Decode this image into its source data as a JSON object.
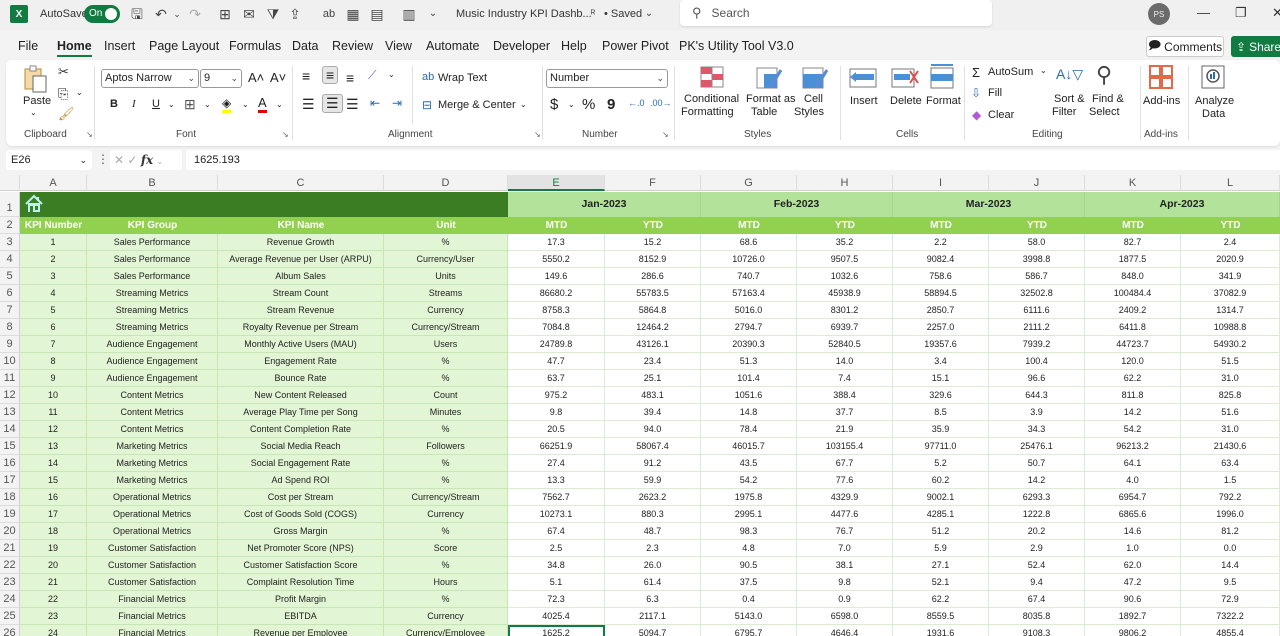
{
  "titlebar": {
    "app_logo": "X",
    "autosave_label": "AutoSave",
    "autosave_state": "On",
    "doc_title": "Music Industry KPI Dashb...",
    "saved_status": "• Saved",
    "search_placeholder": "Search",
    "user_initials": "PS"
  },
  "menu": {
    "tabs": [
      "File",
      "Home",
      "Insert",
      "Page Layout",
      "Formulas",
      "Data",
      "Review",
      "View",
      "Automate",
      "Developer",
      "Help",
      "Power Pivot",
      "PK's Utility Tool V3.0"
    ],
    "active_tab": "Home",
    "comments_label": "Comments",
    "share_label": "Share"
  },
  "ribbon": {
    "clipboard": {
      "paste": "Paste",
      "label": "Clipboard"
    },
    "font": {
      "name": "Aptos Narrow",
      "size": "9",
      "label": "Font",
      "bold": "B",
      "italic": "I",
      "underline": "U"
    },
    "alignment": {
      "wrap_text": "Wrap Text",
      "merge_center": "Merge & Center",
      "label": "Alignment"
    },
    "number": {
      "format": "Number",
      "currency": "$",
      "percent": "%",
      "comma": "9",
      "label": "Number"
    },
    "styles": {
      "conditional": "Conditional",
      "conditional2": "Formatting",
      "format_as": "Format as",
      "format_as2": "Table",
      "cell": "Cell",
      "cell2": "Styles",
      "label": "Styles"
    },
    "cells": {
      "insert": "Insert",
      "delete": "Delete",
      "format": "Format",
      "label": "Cells"
    },
    "editing": {
      "autosum": "AutoSum",
      "fill": "Fill",
      "clear": "Clear",
      "sort": "Sort &",
      "sort2": "Filter",
      "find": "Find &",
      "find2": "Select",
      "label": "Editing"
    },
    "addins": {
      "addins": "Add-ins",
      "label": "Add-ins"
    },
    "analyze": {
      "line1": "Analyze",
      "line2": "Data"
    }
  },
  "formula_bar": {
    "name_box": "E26",
    "formula": "1625.193"
  },
  "sheet": {
    "columns": [
      "A",
      "B",
      "C",
      "D",
      "E",
      "F",
      "G",
      "H",
      "I",
      "J",
      "K",
      "L"
    ],
    "selected_column": "E",
    "selected_cell": "E26",
    "header_row": [
      "KPI Number",
      "KPI Group",
      "KPI Name",
      "Unit"
    ],
    "months": [
      "Jan-2023",
      "Feb-2023",
      "Mar-2023",
      "Apr-2023"
    ],
    "sub_headers": [
      "MTD",
      "YTD"
    ],
    "rows": [
      {
        "n": "1",
        "group": "Sales Performance",
        "name": "Revenue Growth",
        "unit": "%",
        "vals": [
          "17.3",
          "15.2",
          "68.6",
          "35.2",
          "2.2",
          "58.0",
          "82.7",
          "2.4"
        ]
      },
      {
        "n": "2",
        "group": "Sales Performance",
        "name": "Average Revenue per User (ARPU)",
        "unit": "Currency/User",
        "vals": [
          "5550.2",
          "8152.9",
          "10726.0",
          "9507.5",
          "9082.4",
          "3998.8",
          "1877.5",
          "2020.9"
        ]
      },
      {
        "n": "3",
        "group": "Sales Performance",
        "name": "Album Sales",
        "unit": "Units",
        "vals": [
          "149.6",
          "286.6",
          "740.7",
          "1032.6",
          "758.6",
          "586.7",
          "848.0",
          "341.9"
        ]
      },
      {
        "n": "4",
        "group": "Streaming Metrics",
        "name": "Stream Count",
        "unit": "Streams",
        "vals": [
          "86680.2",
          "55783.5",
          "57163.4",
          "45938.9",
          "58894.5",
          "32502.8",
          "100484.4",
          "37082.9"
        ]
      },
      {
        "n": "5",
        "group": "Streaming Metrics",
        "name": "Stream Revenue",
        "unit": "Currency",
        "vals": [
          "8758.3",
          "5864.8",
          "5016.0",
          "8301.2",
          "2850.7",
          "6111.6",
          "2409.2",
          "1314.7"
        ]
      },
      {
        "n": "6",
        "group": "Streaming Metrics",
        "name": "Royalty Revenue per Stream",
        "unit": "Currency/Stream",
        "vals": [
          "7084.8",
          "12464.2",
          "2794.7",
          "6939.7",
          "2257.0",
          "2111.2",
          "6411.8",
          "10988.8"
        ]
      },
      {
        "n": "7",
        "group": "Audience Engagement",
        "name": "Monthly Active Users (MAU)",
        "unit": "Users",
        "vals": [
          "24789.8",
          "43126.1",
          "20390.3",
          "52840.5",
          "19357.6",
          "7939.2",
          "44723.7",
          "54930.2"
        ]
      },
      {
        "n": "8",
        "group": "Audience Engagement",
        "name": "Engagement Rate",
        "unit": "%",
        "vals": [
          "47.7",
          "23.4",
          "51.3",
          "14.0",
          "3.4",
          "100.4",
          "120.0",
          "51.5"
        ]
      },
      {
        "n": "9",
        "group": "Audience Engagement",
        "name": "Bounce Rate",
        "unit": "%",
        "vals": [
          "63.7",
          "25.1",
          "101.4",
          "7.4",
          "15.1",
          "96.6",
          "62.2",
          "31.0"
        ]
      },
      {
        "n": "10",
        "group": "Content Metrics",
        "name": "New Content Released",
        "unit": "Count",
        "vals": [
          "975.2",
          "483.1",
          "1051.6",
          "388.4",
          "329.6",
          "644.3",
          "811.8",
          "825.8"
        ]
      },
      {
        "n": "11",
        "group": "Content Metrics",
        "name": "Average Play Time per Song",
        "unit": "Minutes",
        "vals": [
          "9.8",
          "39.4",
          "14.8",
          "37.7",
          "8.5",
          "3.9",
          "14.2",
          "51.6"
        ]
      },
      {
        "n": "12",
        "group": "Content Metrics",
        "name": "Content Completion Rate",
        "unit": "%",
        "vals": [
          "20.5",
          "94.0",
          "78.4",
          "21.9",
          "35.9",
          "34.3",
          "54.2",
          "31.0"
        ]
      },
      {
        "n": "13",
        "group": "Marketing Metrics",
        "name": "Social Media Reach",
        "unit": "Followers",
        "vals": [
          "66251.9",
          "58067.4",
          "46015.7",
          "103155.4",
          "97711.0",
          "25476.1",
          "96213.2",
          "21430.6"
        ]
      },
      {
        "n": "14",
        "group": "Marketing Metrics",
        "name": "Social Engagement Rate",
        "unit": "%",
        "vals": [
          "27.4",
          "91.2",
          "43.5",
          "67.7",
          "5.2",
          "50.7",
          "64.1",
          "63.4"
        ]
      },
      {
        "n": "15",
        "group": "Marketing Metrics",
        "name": "Ad Spend ROI",
        "unit": "%",
        "vals": [
          "13.3",
          "59.9",
          "54.2",
          "77.6",
          "60.2",
          "14.2",
          "4.0",
          "1.5"
        ]
      },
      {
        "n": "16",
        "group": "Operational Metrics",
        "name": "Cost per Stream",
        "unit": "Currency/Stream",
        "vals": [
          "7562.7",
          "2623.2",
          "1975.8",
          "4329.9",
          "9002.1",
          "6293.3",
          "6954.7",
          "792.2"
        ]
      },
      {
        "n": "17",
        "group": "Operational Metrics",
        "name": "Cost of Goods Sold (COGS)",
        "unit": "Currency",
        "vals": [
          "10273.1",
          "880.3",
          "2995.1",
          "4477.6",
          "4285.1",
          "1222.8",
          "6865.6",
          "1996.0"
        ]
      },
      {
        "n": "18",
        "group": "Operational Metrics",
        "name": "Gross Margin",
        "unit": "%",
        "vals": [
          "67.4",
          "48.7",
          "98.3",
          "76.7",
          "51.2",
          "20.2",
          "14.6",
          "81.2"
        ]
      },
      {
        "n": "19",
        "group": "Customer Satisfaction",
        "name": "Net Promoter Score (NPS)",
        "unit": "Score",
        "vals": [
          "2.5",
          "2.3",
          "4.8",
          "7.0",
          "5.9",
          "2.9",
          "1.0",
          "0.0"
        ]
      },
      {
        "n": "20",
        "group": "Customer Satisfaction",
        "name": "Customer Satisfaction Score",
        "unit": "%",
        "vals": [
          "34.8",
          "26.0",
          "90.5",
          "38.1",
          "27.1",
          "52.4",
          "62.0",
          "14.4"
        ]
      },
      {
        "n": "21",
        "group": "Customer Satisfaction",
        "name": "Complaint Resolution Time",
        "unit": "Hours",
        "vals": [
          "5.1",
          "61.4",
          "37.5",
          "9.8",
          "52.1",
          "9.4",
          "47.2",
          "9.5"
        ]
      },
      {
        "n": "22",
        "group": "Financial Metrics",
        "name": "Profit Margin",
        "unit": "%",
        "vals": [
          "72.3",
          "6.3",
          "0.4",
          "0.9",
          "62.2",
          "67.4",
          "90.6",
          "72.9"
        ]
      },
      {
        "n": "23",
        "group": "Financial Metrics",
        "name": "EBITDA",
        "unit": "Currency",
        "vals": [
          "4025.4",
          "2117.1",
          "5143.0",
          "6598.0",
          "8559.5",
          "8035.8",
          "1892.7",
          "7322.2"
        ]
      },
      {
        "n": "24",
        "group": "Financial Metrics",
        "name": "Revenue per Employee",
        "unit": "Currency/Employee",
        "vals": [
          "1625.2",
          "5094.7",
          "6795.7",
          "4646.4",
          "1931.6",
          "9108.3",
          "9806.2",
          "4855.4"
        ]
      }
    ]
  },
  "colors": {
    "excel_green": "#107c41",
    "title_band": "#3a7d22",
    "header_band": "#92d050",
    "month_band": "#b3e39b",
    "info_cells": "#e2f5d4"
  }
}
